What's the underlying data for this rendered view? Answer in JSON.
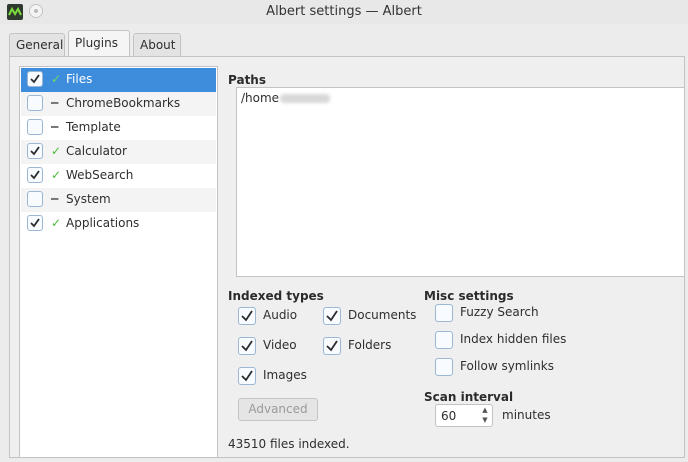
{
  "window": {
    "title": "Albert settings — Albert"
  },
  "tabs": [
    {
      "label": "General",
      "active": false
    },
    {
      "label": "Plugins",
      "active": true
    },
    {
      "label": "About",
      "active": false
    }
  ],
  "plugins": [
    {
      "name": "Files",
      "enabled": true,
      "status": "✓",
      "selected": true
    },
    {
      "name": "ChromeBookmarks",
      "enabled": false,
      "status": "━",
      "selected": false
    },
    {
      "name": "Template",
      "enabled": false,
      "status": "━",
      "selected": false
    },
    {
      "name": "Calculator",
      "enabled": true,
      "status": "✓",
      "selected": false
    },
    {
      "name": "WebSearch",
      "enabled": true,
      "status": "✓",
      "selected": false
    },
    {
      "name": "System",
      "enabled": false,
      "status": "━",
      "selected": false
    },
    {
      "name": "Applications",
      "enabled": true,
      "status": "✓",
      "selected": false
    }
  ],
  "files_plugin": {
    "paths_label": "Paths",
    "paths": [
      "/home"
    ],
    "indexed_types_label": "Indexed types",
    "indexed_types": {
      "audio": {
        "label": "Audio",
        "checked": true
      },
      "documents": {
        "label": "Documents",
        "checked": true
      },
      "video": {
        "label": "Video",
        "checked": true
      },
      "folders": {
        "label": "Folders",
        "checked": true
      },
      "images": {
        "label": "Images",
        "checked": true
      }
    },
    "advanced_label": "Advanced",
    "misc_label": "Misc settings",
    "misc": {
      "fuzzy": {
        "label": "Fuzzy Search",
        "checked": false
      },
      "hidden": {
        "label": "Index hidden files",
        "checked": false
      },
      "symlinks": {
        "label": "Follow symlinks",
        "checked": false
      }
    },
    "scan_interval_label": "Scan interval",
    "scan_interval_value": "60",
    "scan_interval_unit": "minutes",
    "status": "43510 files indexed."
  },
  "colors": {
    "selection": "#3d8ddc",
    "check_ok": "#4cbb3a",
    "checkmark": "#2b2b2b"
  }
}
